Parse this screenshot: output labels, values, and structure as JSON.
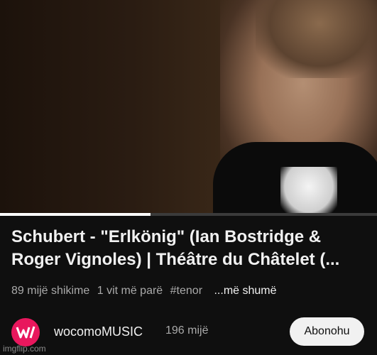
{
  "video": {
    "progress_fraction": 0.4
  },
  "title": "Schubert - \"Erlkönig\" (Ian Bostridge & Roger Vignoles) | Théâtre du Châtelet (...",
  "meta": {
    "views": "89 mijë shikime",
    "age": "1 vit më parë",
    "hashtag": "#tenor",
    "more": "...më shumë"
  },
  "channel": {
    "name": "wocomoMUSIC",
    "subscribers": "196 mijë",
    "avatar_color": "#e8175d",
    "avatar_icon": "wocomo-logo-icon"
  },
  "subscribe_label": "Abonohu",
  "watermark": "imgflip.com"
}
